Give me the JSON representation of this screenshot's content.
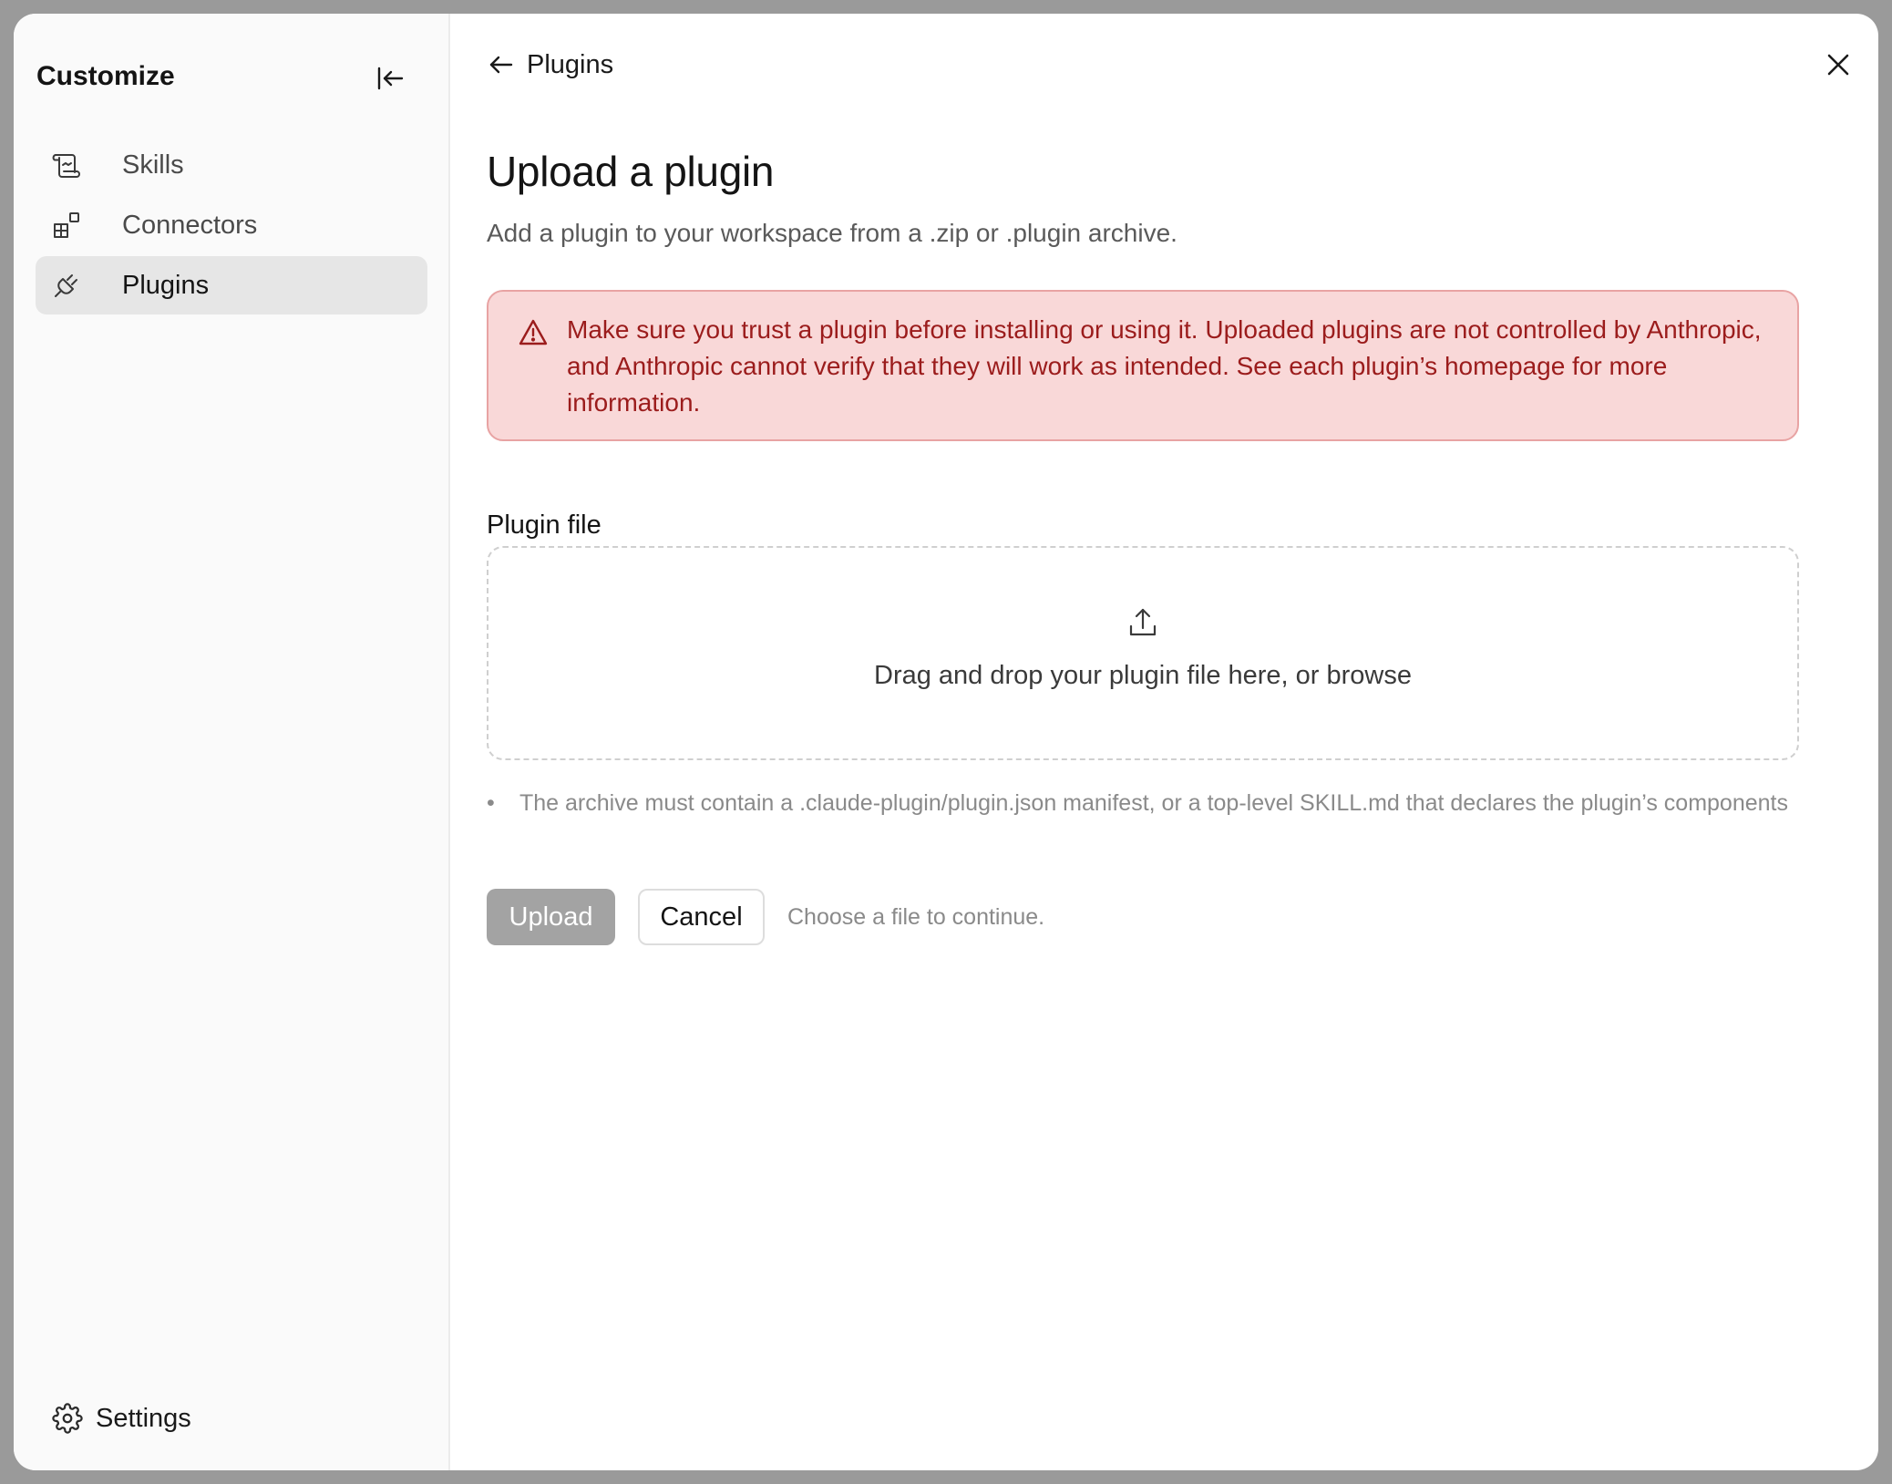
{
  "sidebar": {
    "title": "Customize",
    "items": [
      {
        "label": "Skills",
        "icon": "scroll-icon",
        "active": false
      },
      {
        "label": "Connectors",
        "icon": "connectors-icon",
        "active": false
      },
      {
        "label": "Plugins",
        "icon": "plug-icon",
        "active": true
      }
    ],
    "settings_label": "Settings"
  },
  "header": {
    "back_label": "Plugins"
  },
  "main": {
    "title": "Upload a plugin",
    "subtitle": "Add a plugin to your workspace from a .zip or .plugin archive.",
    "warning": "Make sure you trust a plugin before installing or using it. Uploaded plugins are not controlled by Anthropic, and Anthropic cannot verify that they will work as intended. See each plugin’s homepage for more information.",
    "field_label": "Plugin file",
    "dropzone_text": "Drag and drop your plugin file here, or browse",
    "hint": "The archive must contain a .claude-plugin/plugin.json manifest, or a top-level SKILL.md that declares the plugin’s components",
    "upload_label": "Upload",
    "cancel_label": "Cancel",
    "action_hint": "Choose a file to continue."
  },
  "colors": {
    "warning_bg": "#f9d8d8",
    "warning_border": "#e8a3a3",
    "warning_text": "#9b1c1c",
    "active_nav": "#e6e6e6",
    "disabled_button": "#a3a3a3"
  }
}
